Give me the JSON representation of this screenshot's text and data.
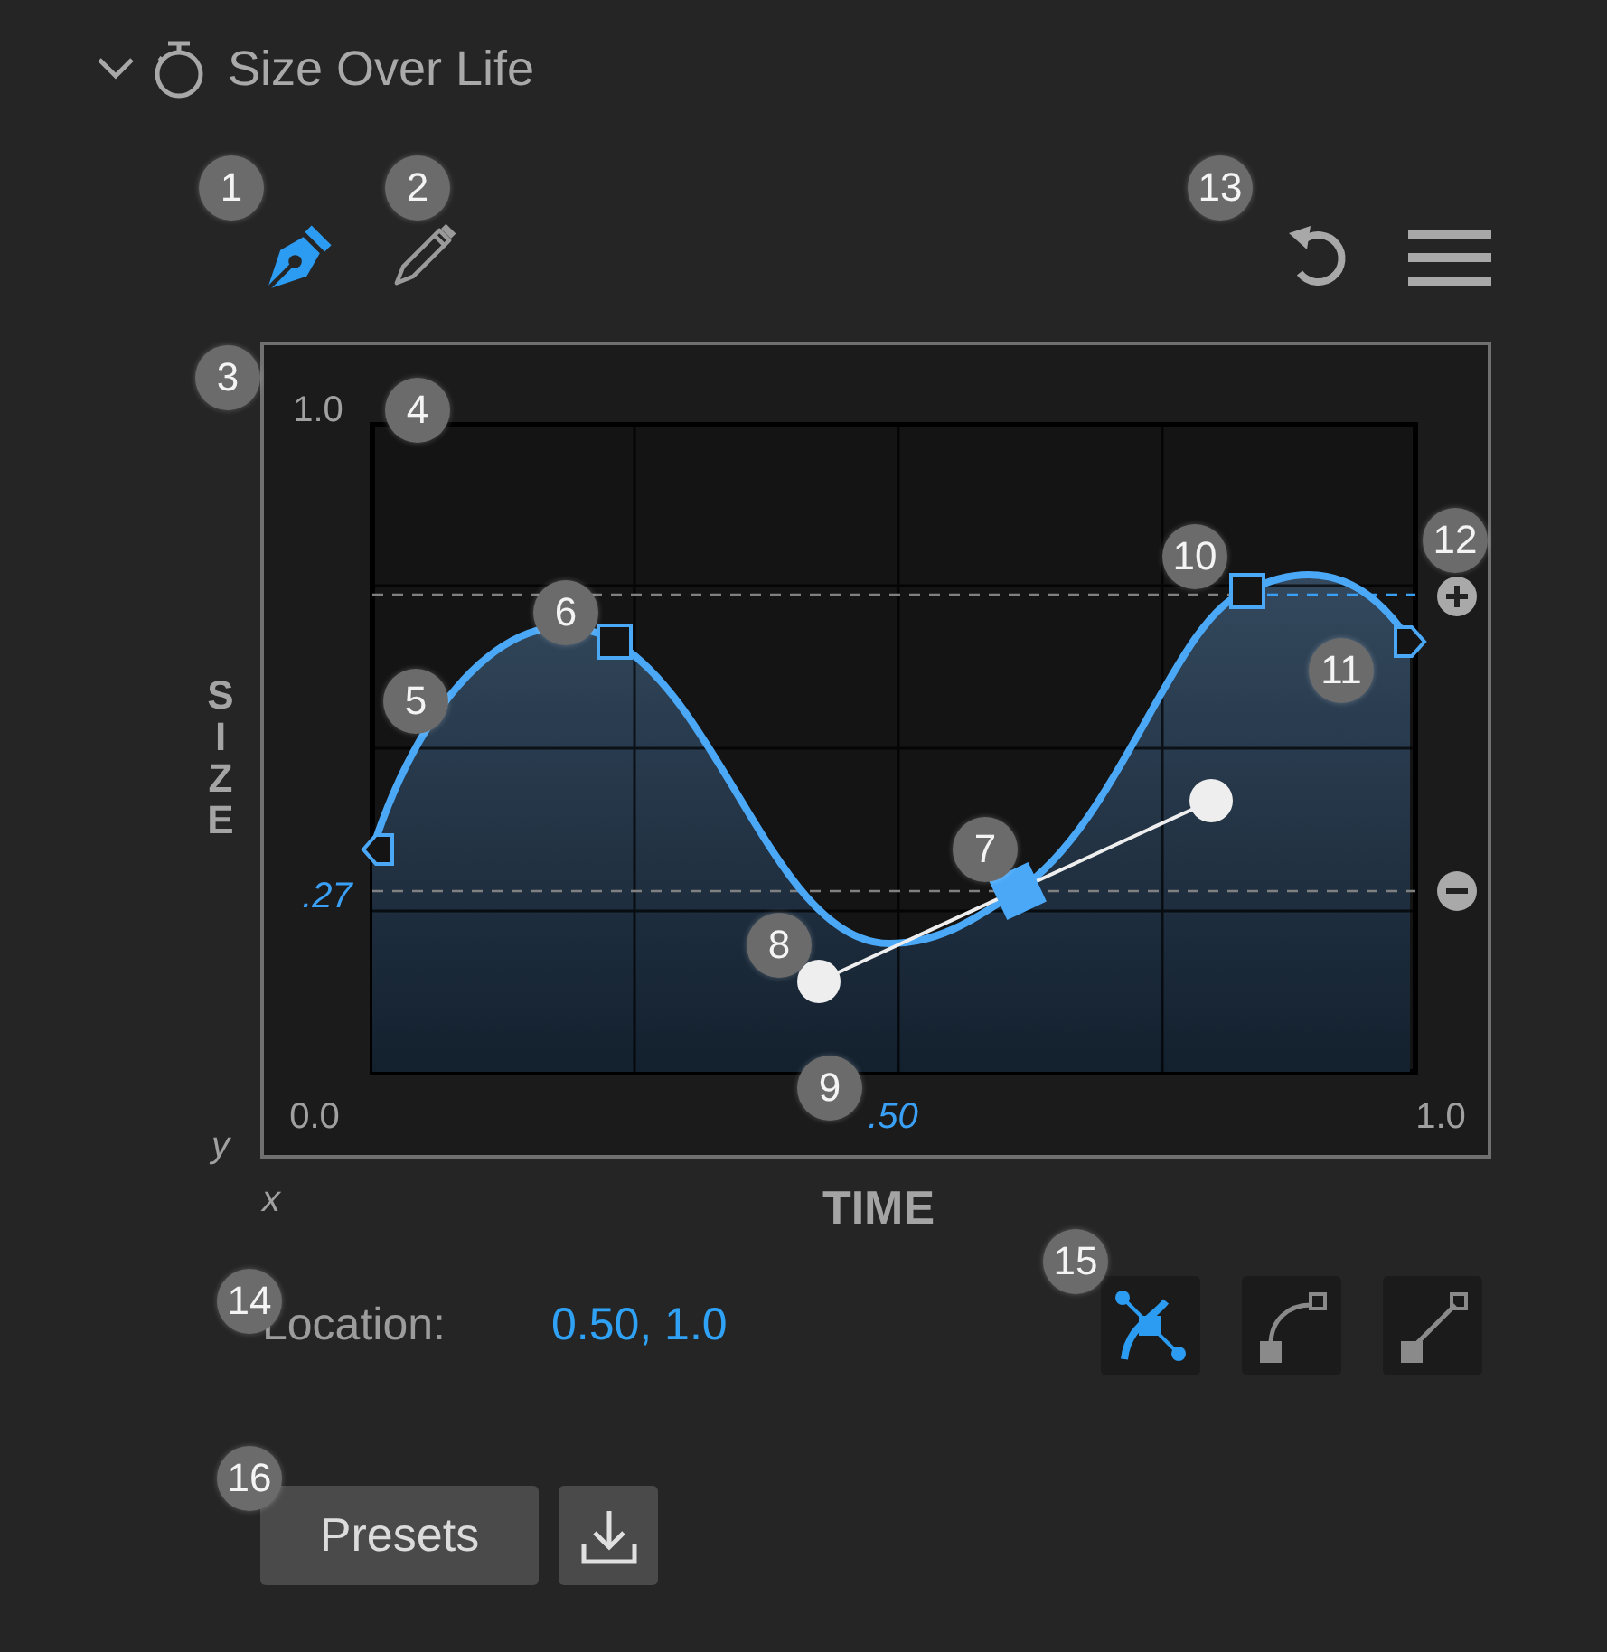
{
  "panel": {
    "title": "Size Over Life",
    "expanded": true
  },
  "tools": [
    {
      "kind": "pen",
      "selected": true
    },
    {
      "kind": "pencil",
      "selected": false
    }
  ],
  "graph": {
    "y_axis_label": "SIZE",
    "y_max": "1.0",
    "y_value": ".27",
    "origin": "0.0",
    "x_value": ".50",
    "x_max": "1.0",
    "y_symbol": "y",
    "x_symbol": "x",
    "x_axis_label": "TIME",
    "keyframes": [
      {
        "kind": "start",
        "selected": false
      },
      {
        "kind": "point",
        "selected": false
      },
      {
        "kind": "point",
        "selected": true
      },
      {
        "kind": "point",
        "selected": false
      },
      {
        "kind": "end",
        "selected": false
      }
    ]
  },
  "location": {
    "label": "Location:",
    "value": "0.50, 1.0"
  },
  "interpolation": [
    {
      "kind": "bezier",
      "selected": true
    },
    {
      "kind": "curve",
      "selected": false
    },
    {
      "kind": "linear",
      "selected": false
    }
  ],
  "presets_button": "Presets",
  "callouts": [
    "1",
    "2",
    "3",
    "4",
    "5",
    "6",
    "7",
    "8",
    "9",
    "10",
    "11",
    "12",
    "13",
    "14",
    "15",
    "16"
  ]
}
